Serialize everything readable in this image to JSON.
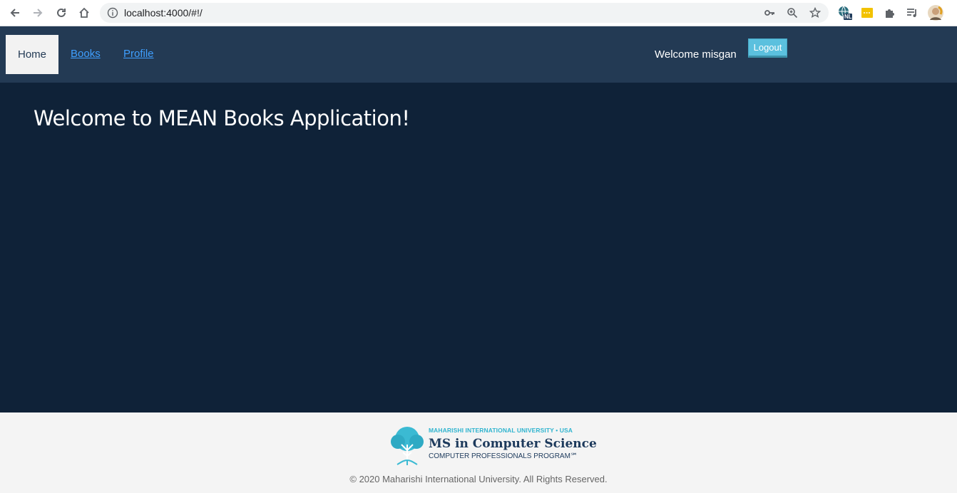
{
  "browser": {
    "url": "localhost:4000/#!/",
    "extension_badge": "NL"
  },
  "nav": {
    "home_label": "Home",
    "books_label": "Books",
    "profile_label": "Profile",
    "welcome_text": "Welcome misgan",
    "logout_label": "Logout"
  },
  "main": {
    "title": "Welcome to MEAN Books Application!"
  },
  "footer": {
    "logo_line1": "MAHARISHI INTERNATIONAL UNIVERSITY • USA",
    "logo_line2": "MS in Computer Science",
    "logo_line3": "COMPUTER PROFESSIONALS PROGRAM℠",
    "copyright": "© 2020 Maharishi International University. All Rights Reserved."
  },
  "colors": {
    "navbar_bg": "#233a54",
    "main_bg": "#0f2238",
    "link": "#3f9fff",
    "logout_bg": "#5bc0de",
    "footer_bg": "#f4f4f4"
  },
  "icons": [
    "back-icon",
    "forward-icon",
    "reload-icon",
    "home-icon",
    "info-icon",
    "key-icon",
    "zoom-icon",
    "star-icon",
    "extension-globe-icon",
    "extension-yellow-icon",
    "puzzle-icon",
    "playlist-icon",
    "profile-avatar"
  ]
}
